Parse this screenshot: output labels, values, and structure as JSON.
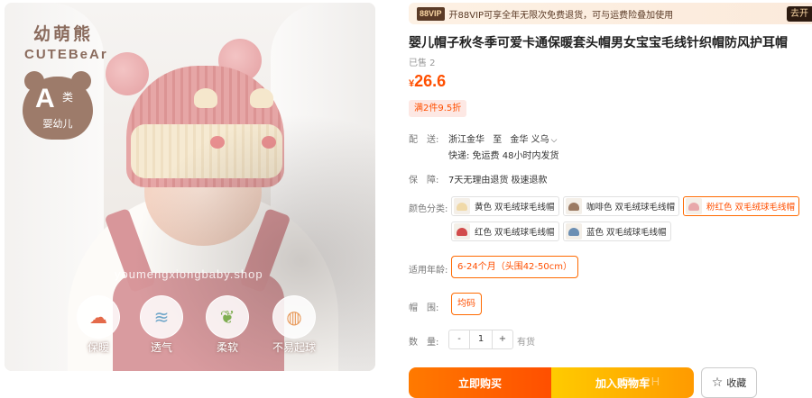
{
  "image": {
    "brand_cn": "幼萌熊",
    "brand_en": "CUTEBeAr",
    "class_badge": {
      "big": "A",
      "small": "类",
      "sub": "婴幼儿"
    },
    "watermark": "youmengxiongbaby.shop",
    "features": [
      {
        "label": "保暖",
        "icon": "cloud-warm-icon"
      },
      {
        "label": "透气",
        "icon": "wind-icon"
      },
      {
        "label": "柔软",
        "icon": "leaf-icon"
      },
      {
        "label": "不易起球",
        "icon": "yarn-ball-icon"
      }
    ]
  },
  "vip": {
    "badge": "88VIP",
    "text": "开88VIP可享全年无限次免费退货，可与运费险叠加使用",
    "button": "去开"
  },
  "product": {
    "title": "婴儿帽子秋冬季可爱卡通保暖套头帽男女宝宝毛线针织帽防风护耳帽",
    "sold": "已售 2",
    "currency": "¥",
    "price": "26.6",
    "promo": "满2件9.5折"
  },
  "shipping": {
    "label": "配　送:",
    "from": "浙江金华",
    "to_word": "至",
    "to": "金华 义乌",
    "detail": "快递: 免运费   48小时内发货"
  },
  "guarantee": {
    "label": "保　障:",
    "text": "7天无理由退货 极速退款"
  },
  "color": {
    "label": "颜色分类:",
    "options": [
      {
        "label": "黄色 双毛绒球毛线帽",
        "hat_color": "#f0d9a8",
        "selected": false
      },
      {
        "label": "咖啡色 双毛绒球毛线帽",
        "hat_color": "#9b7a63",
        "selected": false
      },
      {
        "label": "粉红色 双毛绒球毛线帽",
        "hat_color": "#e8a8aa",
        "selected": true
      },
      {
        "label": "红色 双毛绒球毛线帽",
        "hat_color": "#d24b4b",
        "selected": false
      },
      {
        "label": "蓝色 双毛绒球毛线帽",
        "hat_color": "#6c8fb3",
        "selected": false
      }
    ]
  },
  "age": {
    "label": "适用年龄:",
    "value": "6-24个月（头围42-50cm）"
  },
  "size": {
    "label": "帽　围:",
    "value": "均码"
  },
  "quantity": {
    "label": "数　量:",
    "minus": "-",
    "value": "1",
    "plus": "+",
    "stock": "有货"
  },
  "actions": {
    "buy": "立即购买",
    "cart": "加入购物车",
    "favorite": "收藏",
    "ghost_watermark": "EL PH"
  },
  "colors": {
    "accent": "#ff4f00",
    "accent_light": "#ff7a00",
    "cart": "#ffb000"
  }
}
